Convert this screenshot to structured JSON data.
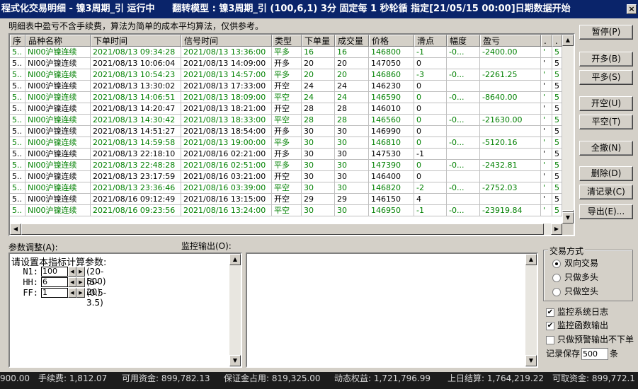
{
  "title": {
    "main": "程式化交易明细 - 镍3周期_引 运行中",
    "model": "翻转模型 : 镍3周期_引 (100,6,1) 3分 固定每 1 秒轮循 指定[21/05/15 00:00]日期数据开始"
  },
  "close_label": "×",
  "note": "明细表中盈亏不含手续费，算法为简单的成本平均算法，仅供参考。",
  "table": {
    "headers": [
      "序",
      "品种名称",
      "下单时间",
      "信号时间",
      "类型",
      "下单量",
      "成交量",
      "价格",
      "滑点",
      "幅度",
      "盈亏",
      ".",
      "."
    ],
    "rows": [
      {
        "seq": "5..",
        "name": "NI00沪镍连续",
        "order_time": "2021/08/13 09:34:28",
        "signal_time": "2021/08/13 13:36:00",
        "type": "平多",
        "qty": "16",
        "filled": "16",
        "price": "146800",
        "slip": "-1",
        "amp": "-0...",
        "pnl": "-2400.00",
        "c1": "'",
        "c2": "5"
      },
      {
        "seq": "5..",
        "name": "NI00沪镍连续",
        "order_time": "2021/08/13 10:06:04",
        "signal_time": "2021/08/13 14:09:00",
        "type": "开多",
        "qty": "20",
        "filled": "20",
        "price": "147050",
        "slip": "0",
        "amp": "",
        "pnl": "",
        "c1": "'",
        "c2": "5"
      },
      {
        "seq": "5..",
        "name": "NI00沪镍连续",
        "order_time": "2021/08/13 10:54:23",
        "signal_time": "2021/08/13 14:57:00",
        "type": "平多",
        "qty": "20",
        "filled": "20",
        "price": "146860",
        "slip": "-3",
        "amp": "-0...",
        "pnl": "-2261.25",
        "c1": "'",
        "c2": "5"
      },
      {
        "seq": "5..",
        "name": "NI00沪镍连续",
        "order_time": "2021/08/13 13:30:02",
        "signal_time": "2021/08/13 17:33:00",
        "type": "开空",
        "qty": "24",
        "filled": "24",
        "price": "146230",
        "slip": "0",
        "amp": "",
        "pnl": "",
        "c1": "'",
        "c2": "5"
      },
      {
        "seq": "5..",
        "name": "NI00沪镍连续",
        "order_time": "2021/08/13 14:06:51",
        "signal_time": "2021/08/13 18:09:00",
        "type": "平空",
        "qty": "24",
        "filled": "24",
        "price": "146590",
        "slip": "0",
        "amp": "-0...",
        "pnl": "-8640.00",
        "c1": "'",
        "c2": "5"
      },
      {
        "seq": "5..",
        "name": "NI00沪镍连续",
        "order_time": "2021/08/13 14:20:47",
        "signal_time": "2021/08/13 18:21:00",
        "type": "开空",
        "qty": "28",
        "filled": "28",
        "price": "146010",
        "slip": "0",
        "amp": "",
        "pnl": "",
        "c1": "'",
        "c2": "5"
      },
      {
        "seq": "5..",
        "name": "NI00沪镍连续",
        "order_time": "2021/08/13 14:30:42",
        "signal_time": "2021/08/13 18:33:00",
        "type": "平空",
        "qty": "28",
        "filled": "28",
        "price": "146560",
        "slip": "0",
        "amp": "-0...",
        "pnl": "-21630.00",
        "c1": "'",
        "c2": "5"
      },
      {
        "seq": "5..",
        "name": "NI00沪镍连续",
        "order_time": "2021/08/13 14:51:27",
        "signal_time": "2021/08/13 18:54:00",
        "type": "开多",
        "qty": "30",
        "filled": "30",
        "price": "146990",
        "slip": "0",
        "amp": "",
        "pnl": "",
        "c1": "'",
        "c2": "5"
      },
      {
        "seq": "5..",
        "name": "NI00沪镍连续",
        "order_time": "2021/08/13 14:59:58",
        "signal_time": "2021/08/13 19:00:00",
        "type": "平多",
        "qty": "30",
        "filled": "30",
        "price": "146810",
        "slip": "0",
        "amp": "-0...",
        "pnl": "-5120.16",
        "c1": "'",
        "c2": "5"
      },
      {
        "seq": "5..",
        "name": "NI00沪镍连续",
        "order_time": "2021/08/13 22:18:10",
        "signal_time": "2021/08/16 02:21:00",
        "type": "开多",
        "qty": "30",
        "filled": "30",
        "price": "147530",
        "slip": "-1",
        "amp": "",
        "pnl": "",
        "c1": "'",
        "c2": "5"
      },
      {
        "seq": "5..",
        "name": "NI00沪镍连续",
        "order_time": "2021/08/13 22:48:28",
        "signal_time": "2021/08/16 02:51:00",
        "type": "平多",
        "qty": "30",
        "filled": "30",
        "price": "147390",
        "slip": "0",
        "amp": "-0...",
        "pnl": "-2432.81",
        "c1": "'",
        "c2": "5"
      },
      {
        "seq": "5..",
        "name": "NI00沪镍连续",
        "order_time": "2021/08/13 23:17:59",
        "signal_time": "2021/08/16 03:21:00",
        "type": "开空",
        "qty": "30",
        "filled": "30",
        "price": "146400",
        "slip": "0",
        "amp": "",
        "pnl": "",
        "c1": "'",
        "c2": "5"
      },
      {
        "seq": "5..",
        "name": "NI00沪镍连续",
        "order_time": "2021/08/13 23:36:46",
        "signal_time": "2021/08/16 03:39:00",
        "type": "平空",
        "qty": "30",
        "filled": "30",
        "price": "146820",
        "slip": "-2",
        "amp": "-0...",
        "pnl": "-2752.03",
        "c1": "'",
        "c2": "5"
      },
      {
        "seq": "5..",
        "name": "NI00沪镍连续",
        "order_time": "2021/08/16 09:12:49",
        "signal_time": "2021/08/16 13:15:00",
        "type": "开空",
        "qty": "29",
        "filled": "29",
        "price": "146150",
        "slip": "4",
        "amp": "",
        "pnl": "",
        "c1": "'",
        "c2": "5"
      },
      {
        "seq": "5..",
        "name": "NI00沪镍连续",
        "order_time": "2021/08/16 09:23:56",
        "signal_time": "2021/08/16 13:24:00",
        "type": "平空",
        "qty": "30",
        "filled": "30",
        "price": "146950",
        "slip": "-1",
        "amp": "-0...",
        "pnl": "-23919.84",
        "c1": "'",
        "c2": "5"
      }
    ]
  },
  "colors": {
    "close_row": "#008000",
    "open_row": "#000000"
  },
  "buttons": {
    "pause": "暂停(P)",
    "open_long": "开多(B)",
    "close_long": "平多(S)",
    "open_short": "开空(U)",
    "close_short": "平空(T)",
    "cancel_all": "全撤(N)",
    "delete": "删除(D)",
    "clear_log": "清记录(C)",
    "export": "导出(E)..."
  },
  "params": {
    "label": "参数调整(A):",
    "title": "请设置本指标计算参数:",
    "items": [
      {
        "name": "N1:",
        "value": "100",
        "range": "(20-500)"
      },
      {
        "name": "HH:",
        "value": "6",
        "range": "(5-20)"
      },
      {
        "name": "FF:",
        "value": "1",
        "range": "(0.5-3.5)"
      }
    ]
  },
  "monitor": {
    "label": "监控输出(O):",
    "content": ""
  },
  "trade_mode": {
    "title": "交易方式",
    "options": [
      "双向交易",
      "只做多头",
      "只做空头"
    ],
    "selected": "双向交易"
  },
  "checks": [
    {
      "label": "监控系统日志",
      "checked": true
    },
    {
      "label": "监控函数输出",
      "checked": true
    },
    {
      "label": "只做预警输出不下单",
      "checked": false
    }
  ],
  "keep": {
    "prefix": "记录保存",
    "value": "500",
    "suffix": "条"
  },
  "status": {
    "s1": "900.00",
    "s2": "手续费: 1,812.07",
    "s3": "可用资金: 899,782.13",
    "s4": "保证金占用: 819,325.00",
    "s5": "动态权益: 1,721,796.99",
    "s6": "上日结算: 1,764,219.22",
    "s7": "可取资金: 899,772.1"
  }
}
